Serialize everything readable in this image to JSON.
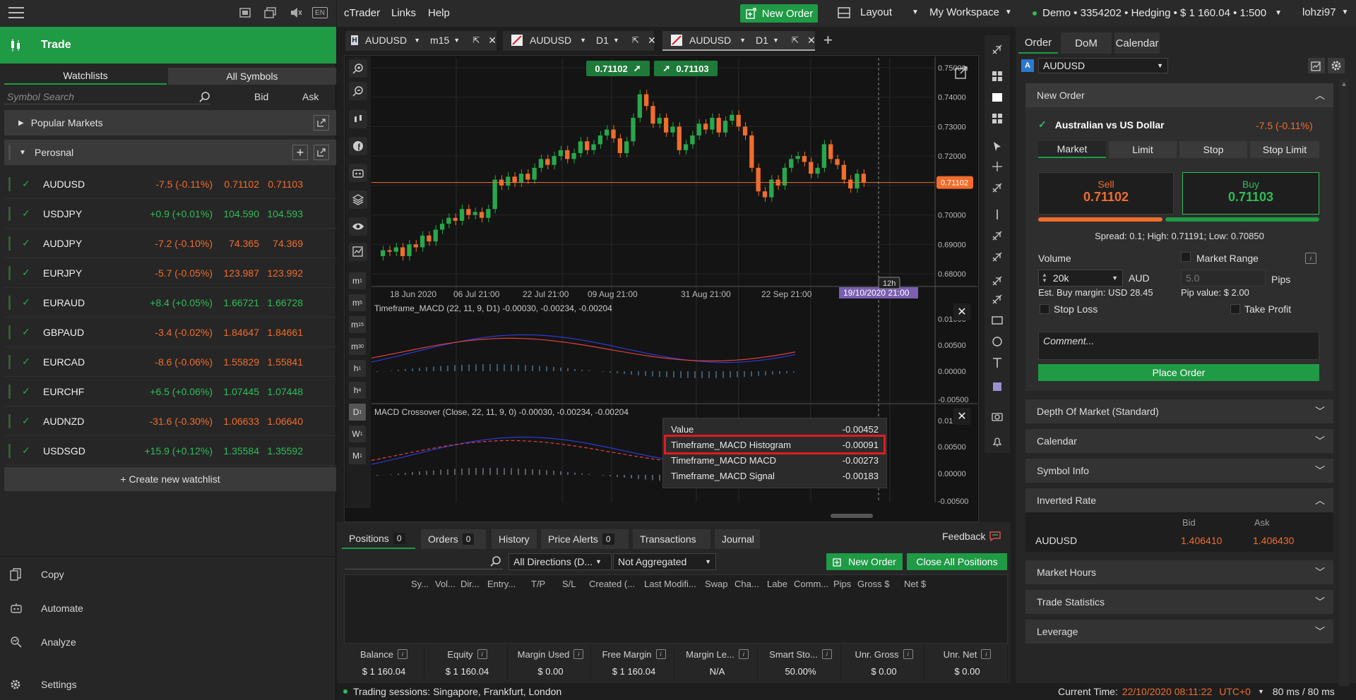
{
  "left": {
    "lang": "EN",
    "trade_title": "Trade",
    "tabs": [
      "Watchlists",
      "All Symbols"
    ],
    "search_placeholder": "Symbol Search",
    "col_bid": "Bid",
    "col_ask": "Ask",
    "popular": "Popular Markets",
    "watchlist_name": "Perosnal",
    "rows": [
      {
        "sym": "AUDUSD",
        "chg": "-7.5 (-0.11%)",
        "dir": "dn",
        "bid": "0.71102",
        "ask": "0.71103"
      },
      {
        "sym": "USDJPY",
        "chg": "+0.9 (+0.01%)",
        "dir": "up",
        "bid": "104.590",
        "ask": "104.593"
      },
      {
        "sym": "AUDJPY",
        "chg": "-7.2 (-0.10%)",
        "dir": "dn",
        "bid": "74.365",
        "ask": "74.369"
      },
      {
        "sym": "EURJPY",
        "chg": "-5.7 (-0.05%)",
        "dir": "dn",
        "bid": "123.987",
        "ask": "123.992"
      },
      {
        "sym": "EURAUD",
        "chg": "+8.4 (+0.05%)",
        "dir": "up",
        "bid": "1.66721",
        "ask": "1.66728"
      },
      {
        "sym": "GBPAUD",
        "chg": "-3.4 (-0.02%)",
        "dir": "dn",
        "bid": "1.84647",
        "ask": "1.84661"
      },
      {
        "sym": "EURCAD",
        "chg": "-8.6 (-0.06%)",
        "dir": "dn",
        "bid": "1.55829",
        "ask": "1.55841"
      },
      {
        "sym": "EURCHF",
        "chg": "+6.5 (+0.06%)",
        "dir": "up",
        "bid": "1.07445",
        "ask": "1.07448"
      },
      {
        "sym": "AUDNZD",
        "chg": "-31.6 (-0.30%)",
        "dir": "dn",
        "bid": "1.06633",
        "ask": "1.06640"
      },
      {
        "sym": "USDSGD",
        "chg": "+15.9 (+0.12%)",
        "dir": "up",
        "bid": "1.35584",
        "ask": "1.35592"
      }
    ],
    "create": "+ Create new watchlist",
    "menu": [
      "Copy",
      "Automate",
      "Analyze",
      "Settings"
    ]
  },
  "top": {
    "menus": [
      "cTrader",
      "Links",
      "Help"
    ],
    "new_order": "New Order",
    "layout": "Layout",
    "workspace": "My Workspace",
    "account": "Demo  •  3354202  •  Hedging  •  $ 1 160.04  •  1:500",
    "user": "lohzi97"
  },
  "chart_tabs": [
    {
      "sym": "AUDUSD",
      "tf": "m15"
    },
    {
      "sym": "AUDUSD",
      "tf": "D1"
    },
    {
      "sym": "AUDUSD",
      "tf": "D1"
    }
  ],
  "chart": {
    "bid_box": "0.71102",
    "ask_box": "0.71103",
    "price_ticks": [
      "0.75000",
      "0.74000",
      "0.73000",
      "0.72000",
      "0.71000",
      "0.70000",
      "0.69000",
      "0.68000"
    ],
    "cur_price": "0.71102",
    "date_ticks": [
      "18 Jun 2020",
      "06 Jul 21:00",
      "22 Jul 21:00",
      "09 Aug 21:00",
      "31 Aug 21:00",
      "22 Sep 21:00"
    ],
    "cursor_date": "19/10/2020 21:00",
    "cursor_tf": "12h",
    "macd1_label": "Timeframe_MACD (22, 11, 9, D1) -0.00030, -0.00234, -0.00204",
    "macd1_ticks": [
      "0.01000",
      "0.00500",
      "0.00000",
      "-0.00500"
    ],
    "macd2_label": "MACD Crossover (Close, 22, 11, 9, 0) -0.00030, -0.00234, -0.00204",
    "macd2_ticks": [
      "0.01000",
      "0.00500",
      "0.00000",
      "-0.00500"
    ],
    "timeframes": [
      [
        "m",
        "1"
      ],
      [
        "m",
        "5"
      ],
      [
        "m",
        "15"
      ],
      [
        "m",
        "30"
      ],
      [
        "h",
        "1"
      ],
      [
        "h",
        "4"
      ],
      [
        "D",
        "1"
      ],
      [
        "W",
        "1"
      ],
      [
        "M",
        "1"
      ]
    ],
    "tooltip": [
      {
        "k": "Value",
        "v": "-0.00452"
      },
      {
        "k": "Timeframe_MACD Histogram",
        "v": "-0.00091"
      },
      {
        "k": "Timeframe_MACD MACD",
        "v": "-0.00273"
      },
      {
        "k": "Timeframe_MACD Signal",
        "v": "-0.00183"
      }
    ]
  },
  "bottom": {
    "tabs": [
      {
        "l": "Positions",
        "c": "0"
      },
      {
        "l": "Orders",
        "c": "0"
      },
      {
        "l": "History",
        "c": ""
      },
      {
        "l": "Price Alerts",
        "c": "0"
      },
      {
        "l": "Transactions",
        "c": ""
      },
      {
        "l": "Journal",
        "c": ""
      }
    ],
    "feedback": "Feedback",
    "dir_select": "All Directions (D...",
    "agg_select": "Not Aggregated",
    "new_order": "New Order",
    "close_all": "Close All Positions",
    "cols": [
      "Sy...",
      "Vol...",
      "Dir...",
      "Entry...",
      "T/P",
      "S/L",
      "Created (...",
      "Last Modifi...",
      "Swap",
      "Cha...",
      "Labe",
      "Comm...",
      "Pips",
      "Gross $",
      "Net $"
    ],
    "summary": [
      {
        "l": "Balance",
        "v": "$ 1 160.04"
      },
      {
        "l": "Equity",
        "v": "$ 1 160.04"
      },
      {
        "l": "Margin Used",
        "v": "$ 0.00"
      },
      {
        "l": "Free Margin",
        "v": "$ 1 160.04"
      },
      {
        "l": "Margin Le...",
        "v": "N/A"
      },
      {
        "l": "Smart Sto...",
        "v": "50.00%"
      },
      {
        "l": "Unr. Gross",
        "v": "$ 0.00"
      },
      {
        "l": "Unr. Net",
        "v": "$ 0.00"
      }
    ]
  },
  "status": {
    "sessions": "Trading sessions: Singapore, Frankfurt, London",
    "time_label": "Current Time:",
    "time": "22/10/2020 08:11:22",
    "tz": "UTC+0",
    "latency": "80 ms / 80 ms"
  },
  "right": {
    "tabs": [
      "Order",
      "DoM",
      "Calendar"
    ],
    "symbol": "AUDUSD",
    "new_order": "New Order",
    "instrument": "Australian vs US Dollar",
    "change": "-7.5 (-0.11%)",
    "order_types": [
      "Market",
      "Limit",
      "Stop",
      "Stop Limit"
    ],
    "sell": "Sell",
    "sell_price": "0.71102",
    "buy": "Buy",
    "buy_price": "0.71103",
    "spread": "Spread: 0.1; High: 0.71191; Low: 0.70850",
    "volume_label": "Volume",
    "volume": "20k",
    "currency": "AUD",
    "market_range": "Market Range",
    "range_val": "5.0",
    "pips": "Pips",
    "margin": "Est. Buy margin: USD 28.45",
    "pip_value": "Pip value: $ 2.00",
    "stop_loss": "Stop Loss",
    "take_profit": "Take Profit",
    "comment_ph": "Comment...",
    "place": "Place Order",
    "sections": [
      "Depth Of Market (Standard)",
      "Calendar",
      "Symbol Info"
    ],
    "inverted": "Inverted Rate",
    "inv_bid": "Bid",
    "inv_ask": "Ask",
    "inv_sym": "AUDUSD",
    "inv_bid_v": "1.406410",
    "inv_ask_v": "1.406430",
    "sections2": [
      "Market Hours",
      "Trade Statistics",
      "Leverage"
    ]
  }
}
